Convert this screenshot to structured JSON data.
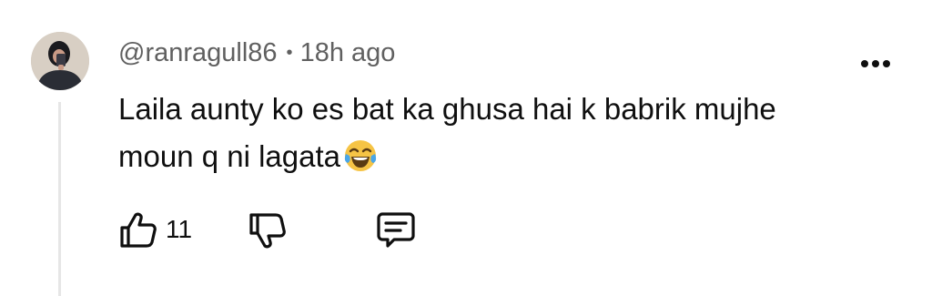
{
  "comment": {
    "author": "@ranragull86",
    "separator": "•",
    "time": "18h ago",
    "text": "Laila aunty ko es bat ka ghusa hai k babrik mujhe moun q ni lagata",
    "emoji": "face-with-tears-of-joy",
    "like_count": "11"
  },
  "icons": {
    "more": "more-vertical-dots-icon",
    "like": "thumbs-up-icon",
    "dislike": "thumbs-down-icon",
    "reply": "reply-comment-icon"
  },
  "colors": {
    "text_primary": "#0f0f0f",
    "text_secondary": "#606060",
    "thread_line": "#e6e6e6",
    "background": "#ffffff"
  }
}
